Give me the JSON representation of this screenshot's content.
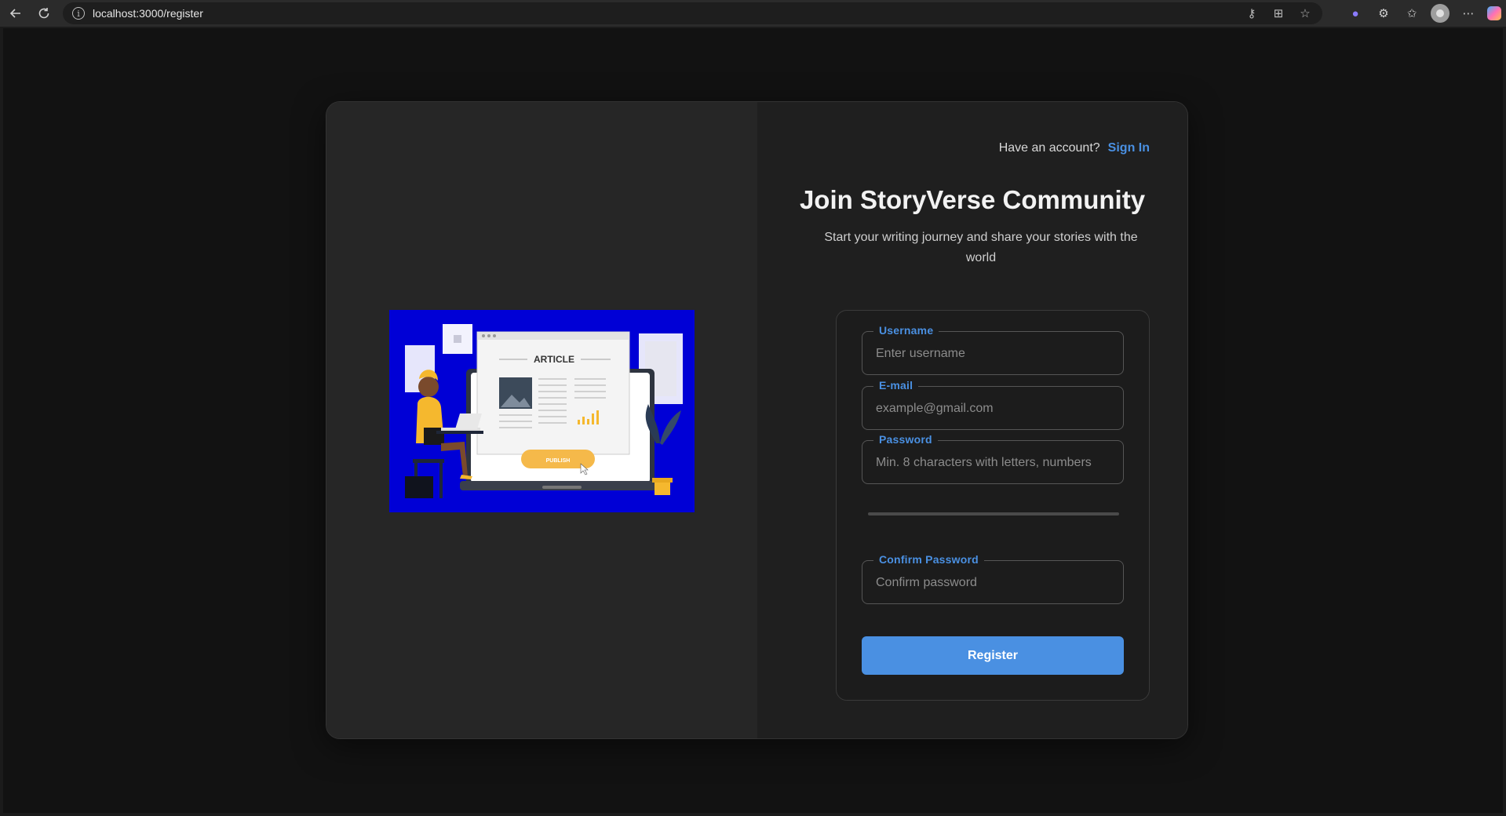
{
  "browser": {
    "url": "localhost:3000/register",
    "back_icon": "arrow-left-icon",
    "refresh_icon": "refresh-icon"
  },
  "auth": {
    "have_account_text": "Have an account?",
    "sign_in_label": "Sign In"
  },
  "header": {
    "title": "Join StoryVerse Community",
    "subtitle": "Start your writing journey and share your stories with the world"
  },
  "illustration": {
    "article_label": "ARTICLE",
    "publish_label": "PUBLISH"
  },
  "form": {
    "username": {
      "label": "Username",
      "placeholder": "Enter username",
      "value": ""
    },
    "email": {
      "label": "E-mail",
      "placeholder": "example@gmail.com",
      "value": ""
    },
    "password": {
      "label": "Password",
      "placeholder": "Min. 8 characters with letters, numbers",
      "value": ""
    },
    "confirm_password": {
      "label": "Confirm Password",
      "placeholder": "Confirm password",
      "value": ""
    },
    "submit_label": "Register"
  },
  "colors": {
    "accent": "#4a90e2",
    "illustration_bg": "#0000d6"
  }
}
